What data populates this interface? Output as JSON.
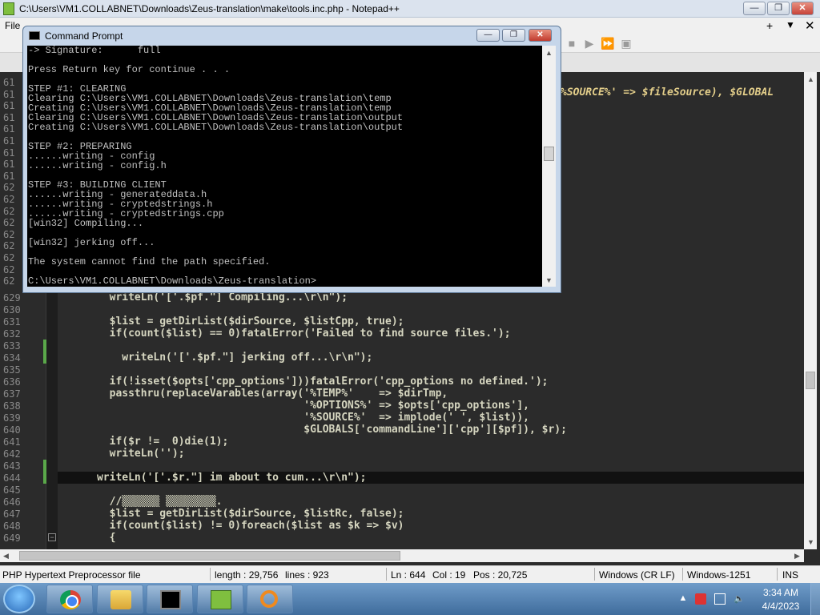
{
  "npp": {
    "title": "C:\\Users\\VM1.COLLABNET\\Downloads\\Zeus-translation\\make\\tools.inc.php - Notepad++",
    "menu_file": "File",
    "win_min": "—",
    "win_max": "❐",
    "win_close": "✕",
    "menu_plus": "+",
    "menu_down": "▼",
    "menu_x": "✕",
    "right_code": "%SOURCE%' => $fileSource), $GLOBAL",
    "hidden_line_numbers": [
      "61",
      "61",
      "61",
      "61",
      "61",
      "61",
      "61",
      "61",
      "61",
      "62",
      "62",
      "62",
      "62",
      "62",
      "62",
      "62",
      "62",
      "62"
    ],
    "lines": [
      {
        "n": "629",
        "code": "        writeLn('['.$pf.\"] Compiling...\\r\\n\");"
      },
      {
        "n": "630",
        "code": ""
      },
      {
        "n": "631",
        "code": "        $list = getDirList($dirSource, $listCpp, true);"
      },
      {
        "n": "632",
        "code": "        if(count($list) == 0)fatalError('Failed to find source files.');"
      },
      {
        "n": "633",
        "code": ""
      },
      {
        "n": "634",
        "code": "          writeLn('['.$pf.\"] jerking off...\\r\\n\");"
      },
      {
        "n": "635",
        "code": ""
      },
      {
        "n": "636",
        "code": "        if(!isset($opts['cpp_options']))fatalError('cpp_options no defined.');"
      },
      {
        "n": "637",
        "code": "        passthru(replaceVarables(array('%TEMP%'    => $dirTmp,"
      },
      {
        "n": "638",
        "code": "                                       '%OPTIONS%' => $opts['cpp_options'],"
      },
      {
        "n": "639",
        "code": "                                       '%SOURCE%'  => implode(' ', $list)),"
      },
      {
        "n": "640",
        "code": "                                       $GLOBALS['commandLine']['cpp'][$pf]), $r);"
      },
      {
        "n": "641",
        "code": "        if($r !=  0)die(1);"
      },
      {
        "n": "642",
        "code": "        writeLn('');"
      },
      {
        "n": "643",
        "code": ""
      },
      {
        "n": "644",
        "code": "      writeLn('['.$r.\"] im about to cum...\\r\\n\");"
      },
      {
        "n": "645",
        "code": ""
      },
      {
        "n": "646",
        "code": "        //▒▒▒▒▒▒ ▒▒▒▒▒▒▒▒."
      },
      {
        "n": "647",
        "code": "        $list = getDirList($dirSource, $listRc, false);"
      },
      {
        "n": "648",
        "code": "        if(count($list) != 0)foreach($list as $k => $v)"
      },
      {
        "n": "649",
        "code": "        {"
      }
    ],
    "status": {
      "file_type": "PHP Hypertext Preprocessor file",
      "length": "length : 29,756",
      "lines": "lines : 923",
      "ln": "Ln : 644",
      "col": "Col : 19",
      "pos": "Pos : 20,725",
      "eol": "Windows (CR LF)",
      "encoding": "Windows-1251",
      "mode": "INS"
    }
  },
  "cmd": {
    "title": "Command Prompt",
    "min": "—",
    "max": "❐",
    "close": "✕",
    "output": "-> Signature:      full\n\nPress Return key for continue . . .\n\nSTEP #1: CLEARING\nClearing C:\\Users\\VM1.COLLABNET\\Downloads\\Zeus-translation\\temp\nCreating C:\\Users\\VM1.COLLABNET\\Downloads\\Zeus-translation\\temp\nClearing C:\\Users\\VM1.COLLABNET\\Downloads\\Zeus-translation\\output\nCreating C:\\Users\\VM1.COLLABNET\\Downloads\\Zeus-translation\\output\n\nSTEP #2: PREPARING\n......writing - config\n......writing - config.h\n\nSTEP #3: BUILDING CLIENT\n......writing - generateddata.h\n......writing - cryptedstrings.h\n......writing - cryptedstrings.cpp\n[win32] Compiling...\n\n[win32] jerking off...\n\nThe system cannot find the path specified.\n\nC:\\Users\\VM1.COLLABNET\\Downloads\\Zeus-translation>"
  },
  "taskbar": {
    "time": "3:34 AM",
    "date": "4/4/2023",
    "tray_arrow": "▲"
  },
  "colors": {
    "editor_bg": "#2b2b2b",
    "keyword": "#e8c75a",
    "changed_marker": "#5aa84a",
    "cmd_bg": "#000000",
    "cmd_text": "#c0c0c0"
  }
}
